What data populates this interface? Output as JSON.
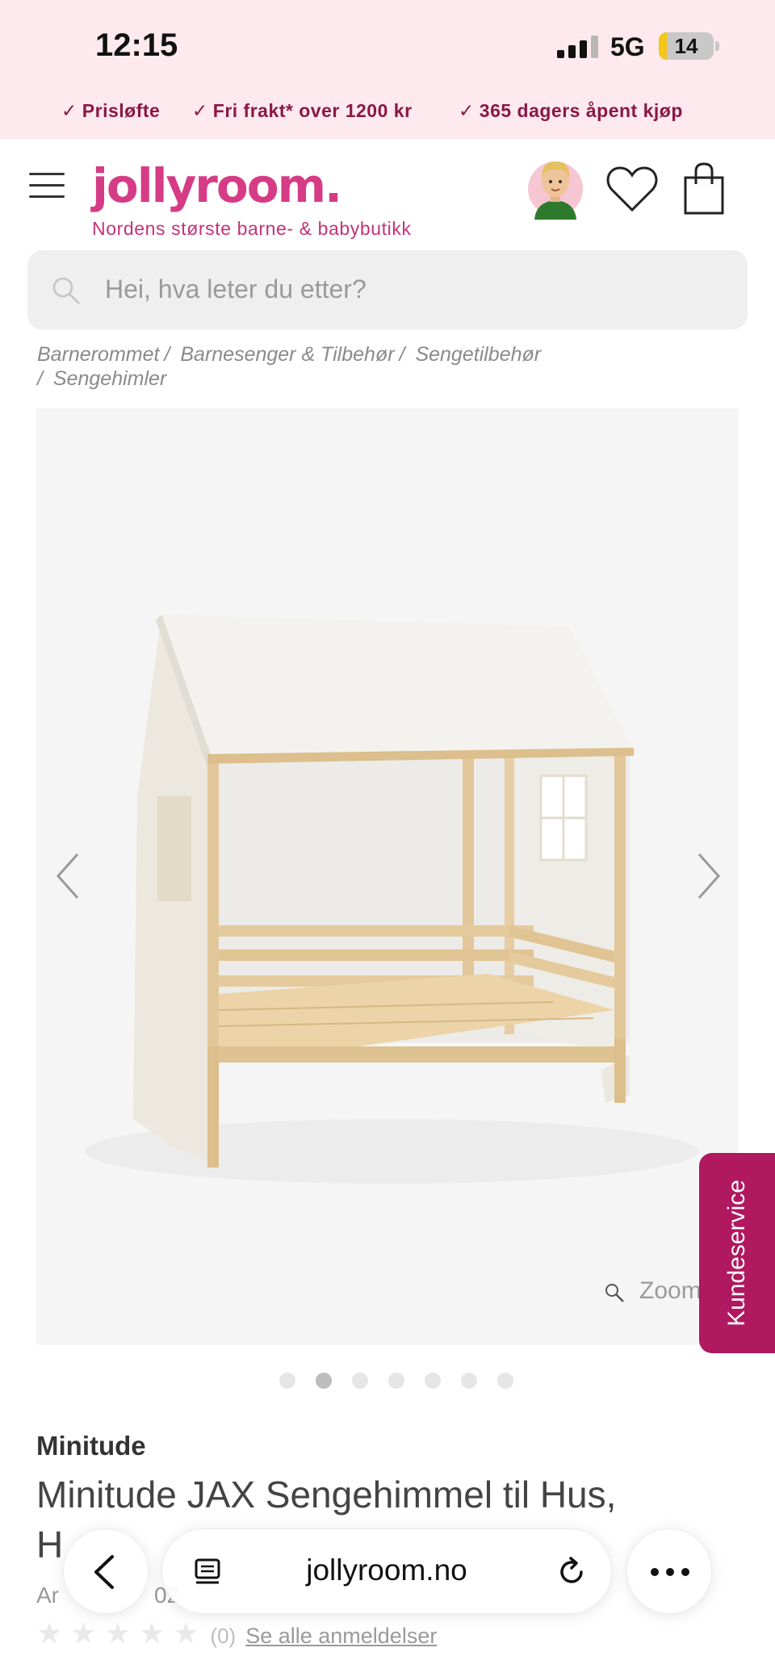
{
  "status_bar": {
    "time": "12:15",
    "network": "5G",
    "battery": "14",
    "battery_fraction": 0.14
  },
  "usp": [
    {
      "label": "Prisløfte"
    },
    {
      "label": "Fri frakt* over 1200 kr"
    },
    {
      "label": "365 dagers åpent kjøp"
    }
  ],
  "header": {
    "logo": "jollyroom.",
    "tagline": "Nordens største barne- & babybutikk"
  },
  "search": {
    "placeholder": "Hei, hva leter du etter?"
  },
  "breadcrumb": {
    "items": [
      "Barnerommet",
      "Barnesenger & Tilbehør",
      "Sengetilbehør",
      "Sengehimler"
    ],
    "separator": "/"
  },
  "gallery": {
    "zoom_label": "Zoom",
    "dots_count": 7,
    "active_dot": 2
  },
  "service_tab": {
    "label": "Kundeservice"
  },
  "product": {
    "brand": "Minitude",
    "title_line1": "Minitude JAX Sengehimmel til Hus,",
    "title_line2_visible": "H",
    "article_visible_start": "Ar",
    "article_visible_end": "02",
    "rating_count": "(0)",
    "all_reviews_label": "Se alle anmeldelser"
  },
  "browser": {
    "url": "jollyroom.no"
  },
  "colors": {
    "top_bg": "#fde9ee",
    "usp_text": "#8a1846",
    "brand_pink": "#d63c86",
    "service_bg": "#b0185f"
  }
}
